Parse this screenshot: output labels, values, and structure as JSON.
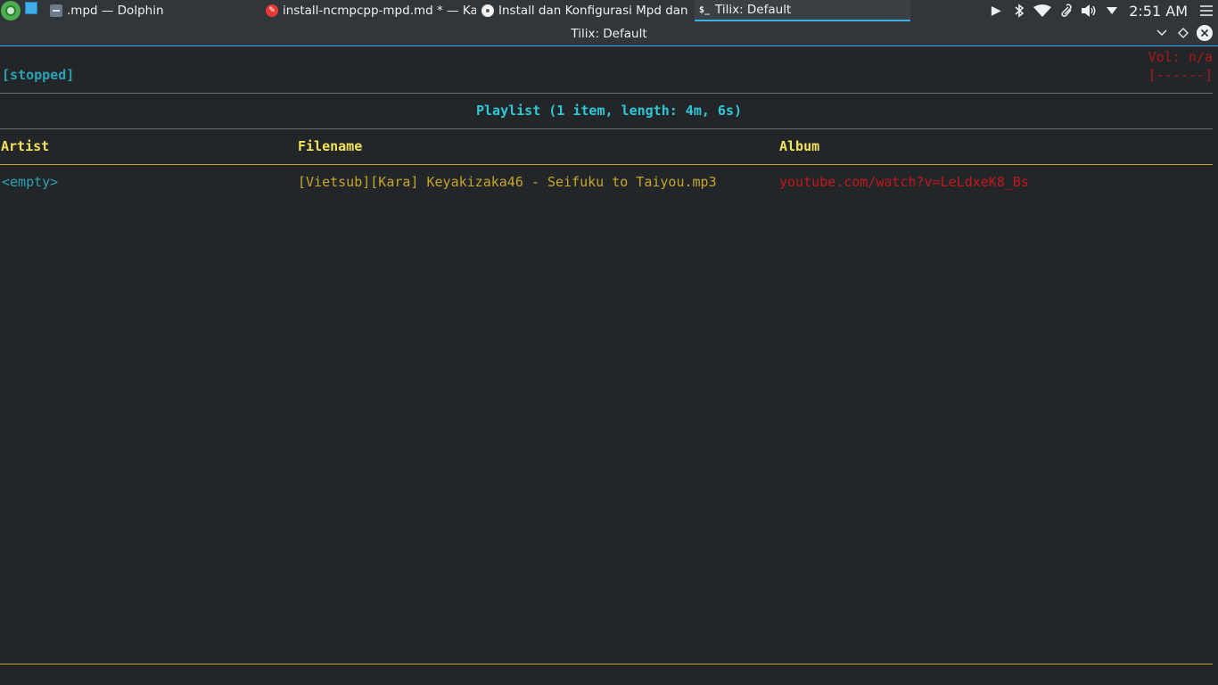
{
  "taskbar": {
    "tasks": [
      {
        "label": ".mpd — Dolphin",
        "icon": "folder-icon"
      },
      {
        "label": "install-ncmpcpp-mpd.md * — Kate",
        "icon": "kate-icon"
      },
      {
        "label": "Install dan Konfigurasi Mpd dan ...",
        "icon": "chrome-icon"
      },
      {
        "label": "Tilix: Default",
        "icon": "tilix-icon"
      }
    ],
    "tray_icons": [
      "play-icon",
      "bluetooth-icon",
      "wifi-icon",
      "paperclip-icon",
      "volume-icon",
      "chevron-down-icon",
      "hamburger-menu-icon"
    ],
    "clock": "2:51 AM"
  },
  "window": {
    "title": "Tilix: Default"
  },
  "ncmpcpp": {
    "state": "[stopped]",
    "volume": "Vol: n/a",
    "volume_bar": "[------]",
    "playlist_title": "Playlist (1 item, length: 4m, 6s)",
    "columns": [
      "Artist",
      "Filename",
      "Album"
    ],
    "rows": [
      {
        "artist": "<empty>",
        "filename": "[Vietsub][Kara] Keyakizaka46 - Seifuku to Taiyou.mp3",
        "album": "youtube.com/watch?v=LeLdxeK8_Bs"
      }
    ]
  },
  "colors": {
    "accent": "#3daee9",
    "header_yellow": "#f2e35c",
    "filename_gold": "#c7a52a",
    "album_red": "#c4171b",
    "cyan": "#2fc7d6"
  }
}
